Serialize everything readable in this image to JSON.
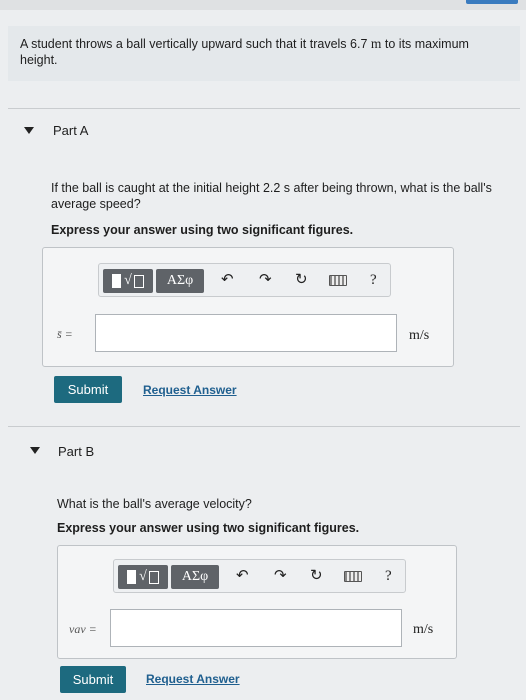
{
  "problem": {
    "text_before": "A student throws a ball vertically upward such that it travels 6.7",
    "unit": "m",
    "text_after": "to its maximum height."
  },
  "parts": [
    {
      "title": "Part A",
      "question": "If the ball is caught at the initial height 2.2 s after being thrown, what is the ball's average speed?",
      "instruction": "Express your answer using two significant figures.",
      "variable_label": "s̄ =",
      "unit": "m/s",
      "input_value": "",
      "submit_label": "Submit",
      "request_label": "Request Answer"
    },
    {
      "title": "Part B",
      "question": "What is the ball's average velocity?",
      "instruction": "Express your answer using two significant figures.",
      "variable_label": "vav =",
      "unit": "m/s",
      "input_value": "",
      "submit_label": "Submit",
      "request_label": "Request Answer"
    }
  ],
  "toolbar": {
    "templates_label": "√",
    "symbols_label": "ΑΣφ",
    "help_label": "?"
  }
}
